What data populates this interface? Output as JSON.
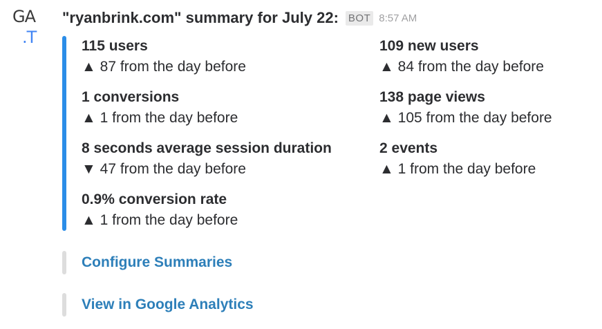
{
  "avatar": {
    "line1": "GA",
    "line2": ".T"
  },
  "message": {
    "sender": "\"ryanbrink.com\" summary for July 22:",
    "badge": "BOT",
    "timestamp": "8:57 AM"
  },
  "colors": {
    "accent_bar": "#2b8de8",
    "link": "#2d7fb9",
    "avatar_t": "#4285f4"
  },
  "fields": [
    {
      "title": "115 users",
      "arrow": "▲",
      "delta": "87 from the day before",
      "direction": "up"
    },
    {
      "title": "109 new users",
      "arrow": "▲",
      "delta": "84 from the day before",
      "direction": "up"
    },
    {
      "title": "1 conversions",
      "arrow": "▲",
      "delta": "1 from the day before",
      "direction": "up"
    },
    {
      "title": "138 page views",
      "arrow": "▲",
      "delta": "105 from the day before",
      "direction": "up"
    },
    {
      "title": "8 seconds average session duration",
      "arrow": "▼",
      "delta": "47 from the day before",
      "direction": "down"
    },
    {
      "title": "2 events",
      "arrow": "▲",
      "delta": "1 from the day before",
      "direction": "up"
    },
    {
      "title": "0.9% conversion rate",
      "arrow": "▲",
      "delta": "1 from the day before",
      "direction": "up"
    }
  ],
  "actions": {
    "configure": "Configure Summaries",
    "view": "View in Google Analytics"
  }
}
